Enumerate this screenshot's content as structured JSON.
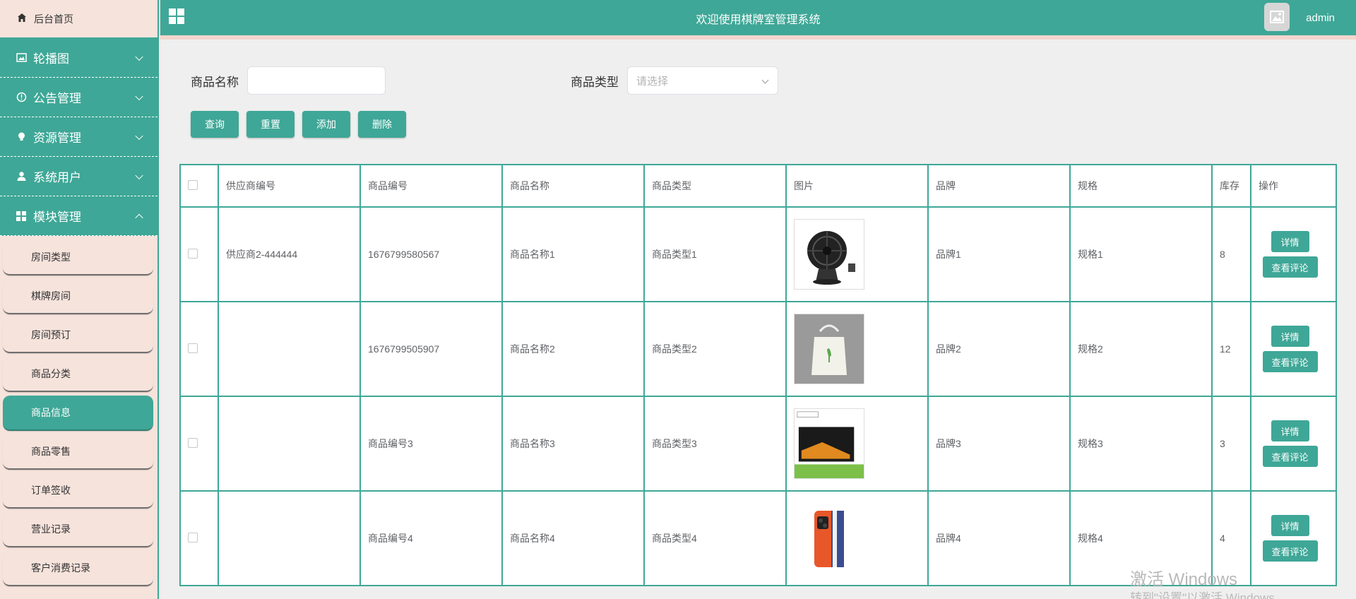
{
  "sidebar": {
    "home_label": "后台首页",
    "groups": [
      {
        "label": "轮播图",
        "icon": "image-icon"
      },
      {
        "label": "公告管理",
        "icon": "info-circle-icon"
      },
      {
        "label": "资源管理",
        "icon": "bulb-icon"
      },
      {
        "label": "系统用户",
        "icon": "user-icon"
      },
      {
        "label": "模块管理",
        "icon": "grid-icon",
        "expanded": true
      }
    ],
    "sub_items": [
      "房间类型",
      "棋牌房间",
      "房间预订",
      "商品分类",
      "商品信息",
      "商品零售",
      "订单签收",
      "营业记录",
      "客户消费记录"
    ],
    "active_sub": "商品信息"
  },
  "header": {
    "title": "欢迎使用棋牌室管理系统",
    "user": "admin"
  },
  "search": {
    "name_label": "商品名称",
    "type_label": "商品类型",
    "type_placeholder": "请选择"
  },
  "buttons": {
    "query": "查询",
    "reset": "重置",
    "add": "添加",
    "delete": "删除"
  },
  "table": {
    "headers": [
      "供应商编号",
      "商品编号",
      "商品名称",
      "商品类型",
      "图片",
      "品牌",
      "规格",
      "库存",
      "操作"
    ],
    "rows": [
      {
        "supplier": "供应商2-444444",
        "code": "1676799580567",
        "name": "商品名称1",
        "type": "商品类型1",
        "image": "fan",
        "brand": "品牌1",
        "spec": "规格1",
        "stock": "8"
      },
      {
        "supplier": "",
        "code": "1676799505907",
        "name": "商品名称2",
        "type": "商品类型2",
        "image": "bag",
        "brand": "品牌2",
        "spec": "规格2",
        "stock": "12"
      },
      {
        "supplier": "",
        "code": "商品编号3",
        "name": "商品名称3",
        "type": "商品类型3",
        "image": "tv",
        "brand": "品牌3",
        "spec": "规格3",
        "stock": "3"
      },
      {
        "supplier": "",
        "code": "商品编号4",
        "name": "商品名称4",
        "type": "商品类型4",
        "image": "phone",
        "brand": "品牌4",
        "spec": "规格4",
        "stock": "4"
      }
    ],
    "op_detail": "详情",
    "op_comments": "查看评论"
  },
  "watermark": {
    "line1": "激活 Windows",
    "line2": "转到\"设置\"以激活 Windows"
  },
  "colors": {
    "primary": "#3fa797",
    "sidebar_bg": "#f6e3dc"
  }
}
